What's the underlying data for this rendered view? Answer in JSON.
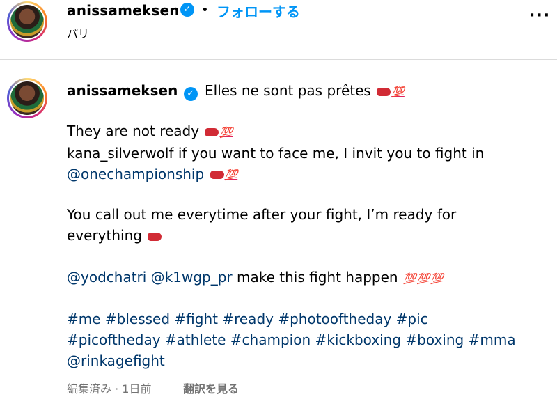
{
  "header": {
    "username": "anissameksen",
    "separator": "•",
    "follow_label": "フォローする",
    "location": "パリ",
    "more_label": "⋮"
  },
  "caption": {
    "username": "anissameksen",
    "lines": [
      "Elles ne sont pas prêtes",
      "They are not ready",
      "kana_silverwolf if you want to face me, I invit you to fight in",
      "@onechampionship",
      "You call out me everytime after your fight, I’m ready for",
      "everything",
      "@yodchatri @k1wgp_pr",
      "make this fight happen",
      "#me #blessed #fight #ready #photooftheday #pic",
      "#picoftheday #athlete #champion #kickboxing #boxing #mma",
      "@rinkagefight"
    ],
    "emoji_100": "💯"
  },
  "footer": {
    "edited": "編集済み · 1日前",
    "translate": "翻訳を見る"
  },
  "colors": {
    "accent": "#0095f6",
    "link": "#00376b",
    "muted": "#737373"
  }
}
